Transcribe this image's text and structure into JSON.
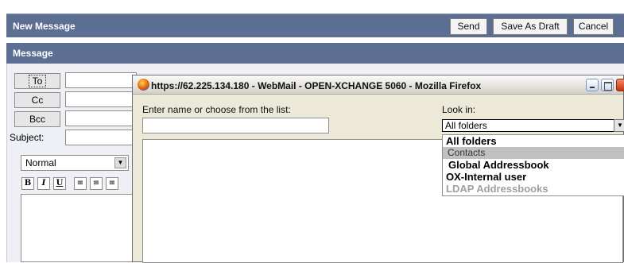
{
  "header": {
    "title": "New Message",
    "buttons": {
      "send": "Send",
      "save_draft": "Save As Draft",
      "cancel": "Cancel"
    }
  },
  "section": {
    "title": "Message"
  },
  "recipients": {
    "to": "To",
    "cc": "Cc",
    "bcc": "Bcc",
    "subject_label": "Subject:"
  },
  "format": {
    "selected": "Normal",
    "toolbar": [
      "B",
      "I",
      "U"
    ]
  },
  "popup": {
    "title": "https://62.225.134.180 - WebMail - OPEN-XCHANGE 5060 - Mozilla Firefox",
    "name_label": "Enter name or choose from the list:",
    "look_in_label": "Look in:",
    "look_in_selected": "All folders",
    "options": [
      "All folders",
      "Contacts",
      "Global Addressbook",
      "OX-Internal user",
      "LDAP Addressbooks"
    ]
  }
}
